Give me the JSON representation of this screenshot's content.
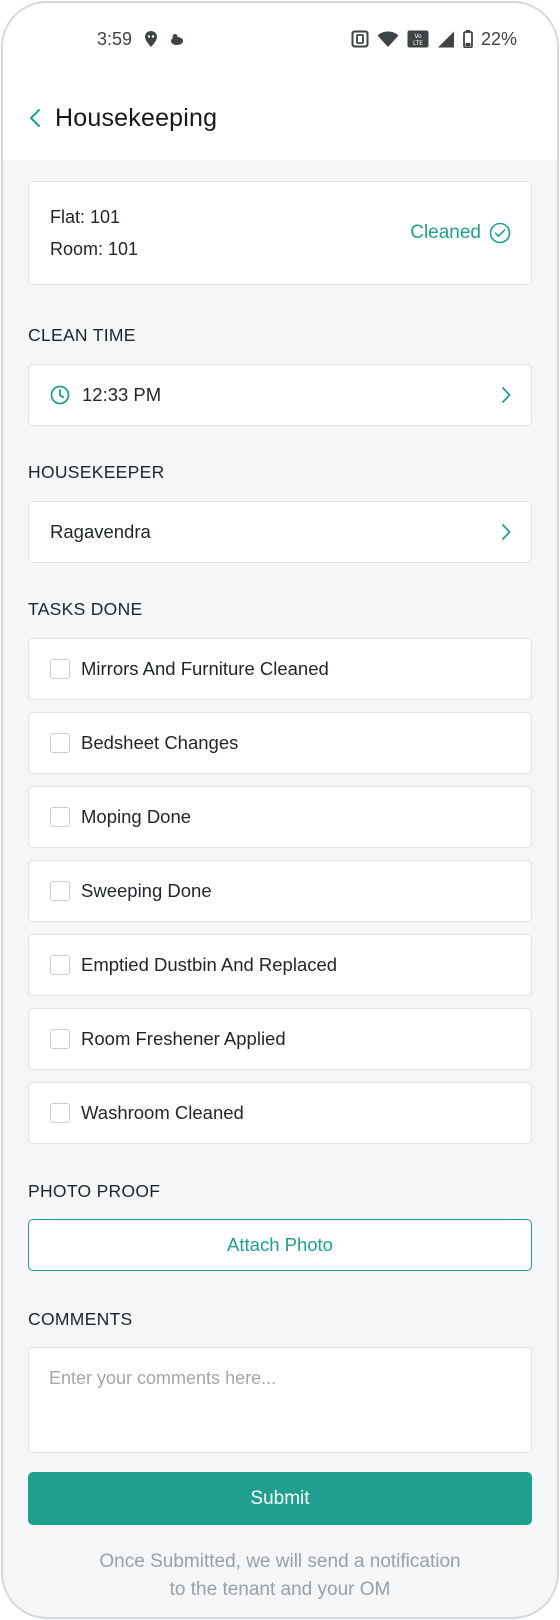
{
  "status_bar": {
    "time": "3:59",
    "battery": "22%"
  },
  "header": {
    "title": "Housekeeping"
  },
  "room": {
    "flat": "Flat: 101",
    "room": "Room: 101",
    "status": "Cleaned"
  },
  "clean_time": {
    "label": "CLEAN TIME",
    "value": "12:33 PM"
  },
  "housekeeper": {
    "label": "HOUSEKEEPER",
    "value": "Ragavendra"
  },
  "tasks": {
    "label": "TASKS DONE",
    "items": [
      {
        "label": "Mirrors And Furniture Cleaned",
        "checked": false
      },
      {
        "label": "Bedsheet Changes",
        "checked": false
      },
      {
        "label": "Moping Done",
        "checked": false
      },
      {
        "label": "Sweeping Done",
        "checked": false
      },
      {
        "label": "Emptied Dustbin And Replaced",
        "checked": false
      },
      {
        "label": "Room Freshener Applied",
        "checked": false
      },
      {
        "label": "Washroom Cleaned",
        "checked": false
      }
    ]
  },
  "photo_proof": {
    "label": "PHOTO PROOF",
    "button": "Attach Photo"
  },
  "comments": {
    "label": "COMMENTS",
    "placeholder": "Enter your comments here...",
    "value": ""
  },
  "submit": {
    "label": "Submit",
    "note_line1": "Once Submitted, we will send a notification",
    "note_line2": "to the tenant and your OM"
  },
  "colors": {
    "accent": "#1fa08f",
    "background": "#f4f6f8",
    "card_border": "#dfe3e6"
  }
}
